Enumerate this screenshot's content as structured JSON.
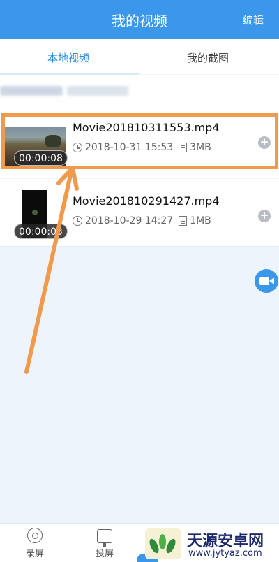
{
  "header": {
    "title": "我的视频",
    "edit_label": "编辑"
  },
  "tabs": [
    {
      "label": "本地视频",
      "active": true
    },
    {
      "label": "我的截图",
      "active": false
    }
  ],
  "videos": [
    {
      "filename": "Movie201810311553.mp4",
      "duration": "00:00:08",
      "datetime": "2018-10-31 15:53",
      "size": "3MB"
    },
    {
      "filename": "Movie201810291427.mp4",
      "duration": "00:00:03",
      "datetime": "2018-10-29 14:27",
      "size": "1MB"
    }
  ],
  "bottom_nav": [
    {
      "label": "录屏",
      "icon": "record-icon"
    },
    {
      "label": "投屏",
      "icon": "cast-icon"
    }
  ],
  "watermark": {
    "title": "天源安卓网",
    "url": "www.jytyaz.com"
  },
  "colors": {
    "primary": "#3a97ea",
    "highlight": "#f29a4c",
    "background": "#eef4fb"
  },
  "annotations": {
    "highlight_box": "orange",
    "arrow": "orange"
  }
}
